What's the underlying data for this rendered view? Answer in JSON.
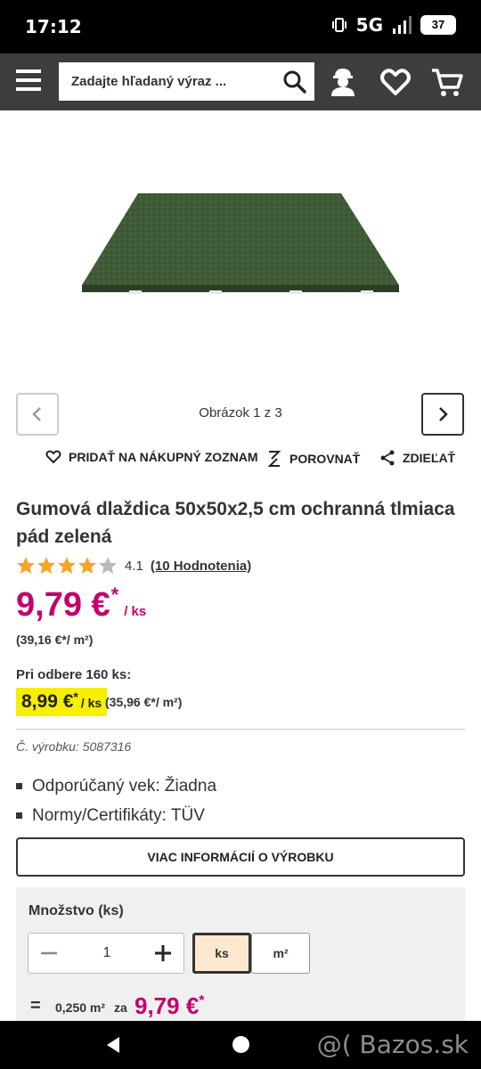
{
  "status_bar": {
    "time": "17:12",
    "network": "5G",
    "battery": "37"
  },
  "header": {
    "search_placeholder": "Zadajte hľadaný výraz ..."
  },
  "gallery": {
    "counter": "Obrázok 1 z 3"
  },
  "actions": {
    "shopping_list": "PRIDAŤ NA NÁKUPNÝ ZOZNAM",
    "compare": "POROVNAŤ",
    "share": "ZDIEĽAŤ"
  },
  "product": {
    "title": "Gumová dlaždica 50x50x2,5 cm ochranná tlmiaca pád zelená",
    "rating_value": "4.1",
    "rating_stars": 4.1,
    "rating_count": "(10 Hodnotenia)",
    "price": "9,79 €",
    "price_star": "*",
    "price_unit": "/ ks",
    "price_per_m2": "(39,16 €*/ m²)",
    "bulk_label": "Pri odbere 160 ks:",
    "bulk_price": "8,99 €",
    "bulk_star": "*",
    "bulk_unit": "/ ks",
    "bulk_per_m2": "(35,96 €*/ m²)",
    "sku": "Č. výrobku: 5087316",
    "features": [
      "Odporúčaný vek: Žiadna",
      "Normy/Certifikáty: TÜV"
    ],
    "more_info": "VIAC INFORMÁCIÍ O VÝROBKU"
  },
  "quantity": {
    "label": "Množstvo (ks)",
    "value": "1",
    "units": [
      "ks",
      "m²"
    ],
    "selected_unit": "ks",
    "equals": "=",
    "area": "0,250 m²",
    "za": "za",
    "total": "9,79 €",
    "total_star": "*"
  },
  "watermark": "@( Bazos.sk",
  "colors": {
    "price": "#c4006f",
    "header": "#3d3d3d",
    "highlight": "#f7ef00",
    "star": "#f5a623"
  }
}
